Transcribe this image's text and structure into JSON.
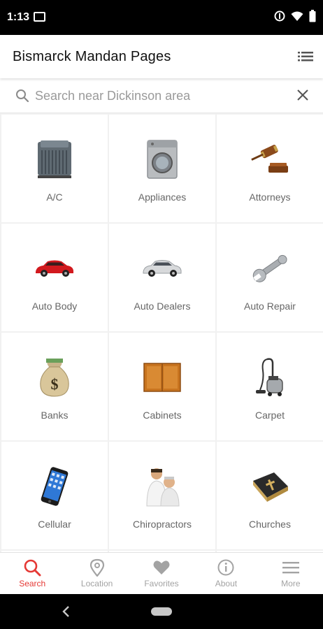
{
  "status_bar": {
    "time": "1:13"
  },
  "header": {
    "title": "Bismarck Mandan Pages",
    "menu_icon": "list-icon"
  },
  "search": {
    "placeholder": "Search near Dickinson area",
    "value": ""
  },
  "categories": [
    {
      "label": "A/C",
      "icon": "air-conditioner-icon"
    },
    {
      "label": "Appliances",
      "icon": "washing-machine-icon"
    },
    {
      "label": "Attorneys",
      "icon": "gavel-icon"
    },
    {
      "label": "Auto Body",
      "icon": "red-car-icon"
    },
    {
      "label": "Auto Dealers",
      "icon": "silver-car-icon"
    },
    {
      "label": "Auto Repair",
      "icon": "wrench-icon"
    },
    {
      "label": "Banks",
      "icon": "money-bag-icon"
    },
    {
      "label": "Cabinets",
      "icon": "cabinet-icon"
    },
    {
      "label": "Carpet",
      "icon": "vacuum-icon"
    },
    {
      "label": "Cellular",
      "icon": "smartphone-icon"
    },
    {
      "label": "Chiropractors",
      "icon": "chiropractor-icon"
    },
    {
      "label": "Churches",
      "icon": "bible-icon"
    }
  ],
  "bottom_nav": [
    {
      "label": "Search",
      "icon": "search-icon",
      "active": true
    },
    {
      "label": "Location",
      "icon": "location-pin-icon",
      "active": false
    },
    {
      "label": "Favorites",
      "icon": "heart-icon",
      "active": false
    },
    {
      "label": "About",
      "icon": "info-icon",
      "active": false
    },
    {
      "label": "More",
      "icon": "menu-icon",
      "active": false
    }
  ],
  "colors": {
    "accent": "#e53935",
    "inactive": "#a3a3a3",
    "label": "#666666"
  }
}
